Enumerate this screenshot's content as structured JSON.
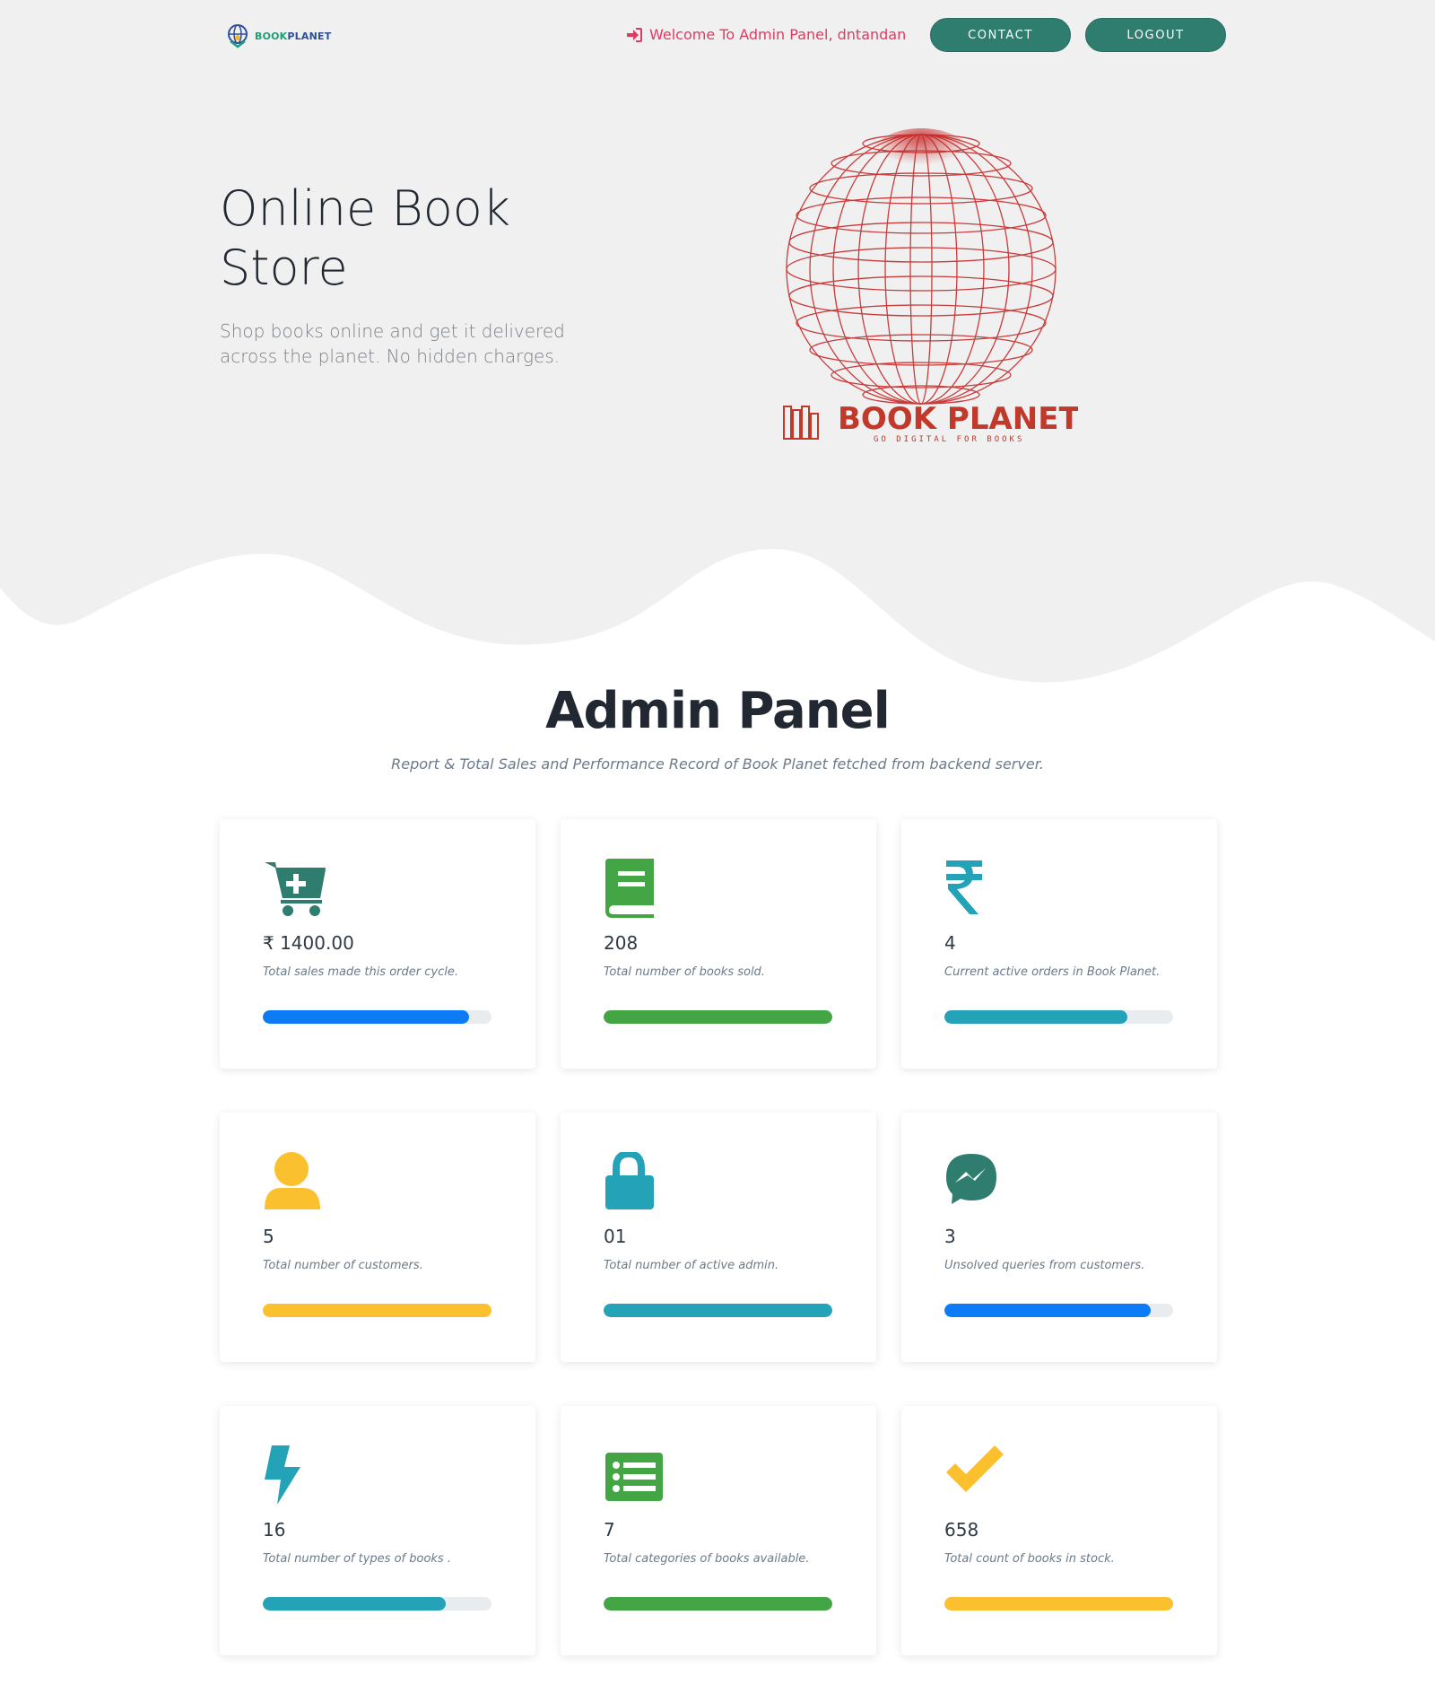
{
  "nav": {
    "brand_part1": "BOOK",
    "brand_part2": "PLANET",
    "welcome_text": "Welcome To Admin Panel, dntandan",
    "contact_label": "CONTACT",
    "logout_label": "LOGOUT"
  },
  "hero": {
    "title": "Online Book Store",
    "subtitle": "Shop books online and get it delivered across the planet. No hidden charges.",
    "logo_name": "BOOK PLANET",
    "logo_tagline": "GO DIGITAL FOR BOOKS"
  },
  "admin": {
    "title": "Admin Panel",
    "subtitle": "Report & Total Sales and Performance Record of Book Planet fetched from backend server."
  },
  "cards": [
    {
      "icon": "cart-plus-icon",
      "value": "₹ 1400.00",
      "desc": "Total sales made this order cycle.",
      "progress": 0.9,
      "color": "#0d7bf5",
      "icon_color": "#2e7d6e"
    },
    {
      "icon": "book-icon",
      "value": "208",
      "desc": "Total number of books sold.",
      "progress": 1.0,
      "color": "#43a543",
      "icon_color": "#43a543"
    },
    {
      "icon": "rupee-icon",
      "value": "4",
      "desc": "Current active orders in Book Planet.",
      "progress": 0.8,
      "color": "#23a2b8",
      "icon_color": "#23a2b8"
    },
    {
      "icon": "user-icon",
      "value": "5",
      "desc": "Total number of customers.",
      "progress": 1.0,
      "color": "#fbc02d",
      "icon_color": "#fbc02d"
    },
    {
      "icon": "lock-icon",
      "value": "01",
      "desc": "Total number of active admin.",
      "progress": 1.0,
      "color": "#23a2b8",
      "icon_color": "#23a2b8"
    },
    {
      "icon": "messenger-icon",
      "value": "3",
      "desc": "Unsolved queries from customers.",
      "progress": 0.9,
      "color": "#0d7bf5",
      "icon_color": "#2e7d6e"
    },
    {
      "icon": "bolt-icon",
      "value": "16",
      "desc": "Total number of types of books .",
      "progress": 0.8,
      "color": "#23a2b8",
      "icon_color": "#23a2b8"
    },
    {
      "icon": "list-icon",
      "value": "7",
      "desc": "Total categories of books available.",
      "progress": 1.0,
      "color": "#43a543",
      "icon_color": "#43a543"
    },
    {
      "icon": "check-icon",
      "value": "658",
      "desc": "Total count of books in stock.",
      "progress": 1.0,
      "color": "#fbc02d",
      "icon_color": "#fbc02d"
    }
  ],
  "colors": {
    "hero_bg": "#f0f0f0",
    "accent": "#2e7d6e",
    "welcome": "#e13a62",
    "logo_red": "#c0392b"
  }
}
